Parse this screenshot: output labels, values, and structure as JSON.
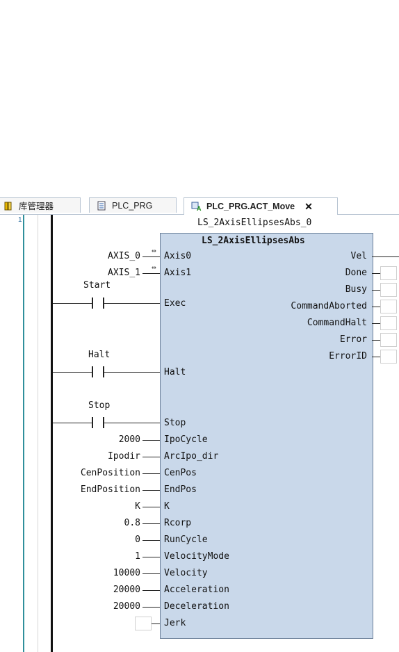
{
  "tabs": [
    {
      "label": "库管理器",
      "icon": "library-icon"
    },
    {
      "label": "PLC_PRG",
      "icon": "document-icon"
    },
    {
      "label": "PLC_PRG.ACT_Move",
      "icon": "action-icon",
      "active": true,
      "close": "✕"
    }
  ],
  "editor": {
    "line_number": "1",
    "instance_name": "LS_2AxisEllipsesAbs_0",
    "fb_type": "LS_2AxisEllipsesAbs",
    "ref_inputs": [
      {
        "var": "AXIS_0",
        "pin": "Axis0"
      },
      {
        "var": "AXIS_1",
        "pin": "Axis1"
      }
    ],
    "contacts": [
      {
        "var": "Start",
        "pin": "Exec"
      },
      {
        "var": "Halt",
        "pin": "Halt"
      },
      {
        "var": "Stop",
        "pin": "Stop"
      }
    ],
    "value_inputs": [
      {
        "value": "2000",
        "pin": "IpoCycle"
      },
      {
        "value": "Ipodir",
        "pin": "ArcIpo_dir"
      },
      {
        "value": "CenPosition",
        "pin": "CenPos"
      },
      {
        "value": "EndPosition",
        "pin": "EndPos"
      },
      {
        "value": "K",
        "pin": "K"
      },
      {
        "value": "0.8",
        "pin": "Rcorp"
      },
      {
        "value": "0",
        "pin": "RunCycle"
      },
      {
        "value": "1",
        "pin": "VelocityMode"
      },
      {
        "value": "10000",
        "pin": "Velocity"
      },
      {
        "value": "20000",
        "pin": "Acceleration"
      },
      {
        "value": "20000",
        "pin": "Deceleration"
      },
      {
        "value": "",
        "pin": "Jerk"
      }
    ],
    "outputs": [
      "Vel",
      "Done",
      "Busy",
      "CommandAborted",
      "CommandHalt",
      "Error",
      "ErrorID"
    ]
  }
}
